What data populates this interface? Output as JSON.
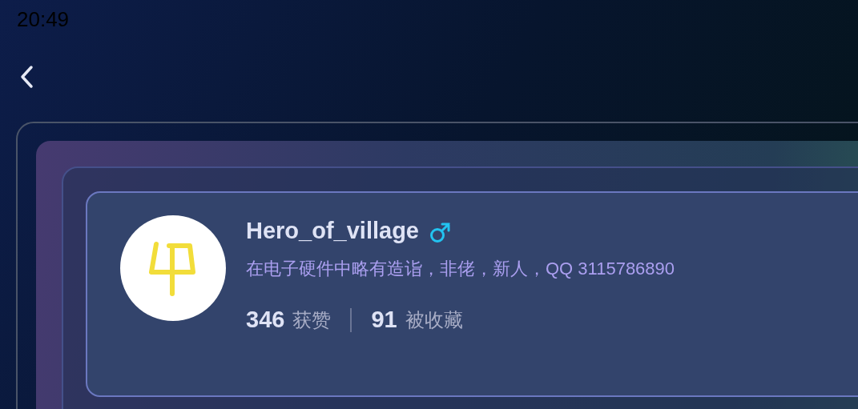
{
  "status_bar": {
    "time": "20:49"
  },
  "profile": {
    "name": "Hero_of_village",
    "gender_icon": {
      "kind": "male"
    },
    "bio": "在电子硬件中略有造诣，非佬，新人，QQ 3115786890",
    "stats": [
      {
        "value": "346",
        "label": "获赞"
      },
      {
        "value": "91",
        "label": "被收藏"
      }
    ]
  }
}
